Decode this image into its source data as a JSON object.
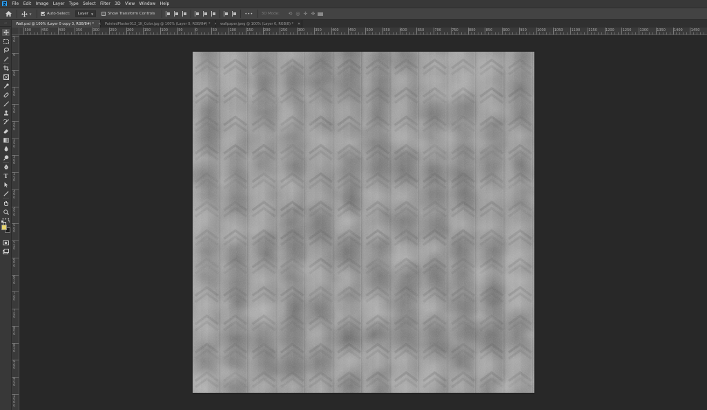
{
  "app": {
    "logo_text": "Ps"
  },
  "menu": [
    "File",
    "Edit",
    "Image",
    "Layer",
    "Type",
    "Select",
    "Filter",
    "3D",
    "View",
    "Window",
    "Help"
  ],
  "options_bar": {
    "auto_select_label": "Auto-Select:",
    "auto_select_checked": true,
    "auto_select_target": "Layer",
    "show_transform_label": "Show Transform Controls",
    "show_transform_checked": false,
    "more_label": "•••",
    "mode_3d_label": "3D Mode:"
  },
  "tabs": [
    {
      "label": "Wall.psd @ 100% (Layer 0 copy 3, RGB/8#) *",
      "active": true
    },
    {
      "label": "PaintedPlaster012_1K_Color.jpg @ 100% (Layer 0, RGB/8#) *",
      "active": false
    },
    {
      "label": "wallpaper.jpeg @ 100% (Layer 0, RGB/8) *",
      "active": false
    }
  ],
  "ruler_top_labels": [
    "500",
    "450",
    "400",
    "350",
    "300",
    "250",
    "200",
    "150",
    "100",
    "50",
    "0",
    "50",
    "100",
    "150",
    "200",
    "250",
    "300",
    "350",
    "400",
    "450",
    "500",
    "550",
    "600",
    "650",
    "700",
    "750",
    "800",
    "850",
    "900",
    "950",
    "1000",
    "1050",
    "1100",
    "1150",
    "1200",
    "1250",
    "1300",
    "1350",
    "1400",
    "1450",
    "1500"
  ],
  "ruler_left_labels": [
    "50",
    "0",
    "50",
    "100",
    "150",
    "200",
    "250",
    "300",
    "350",
    "400",
    "450",
    "500",
    "550",
    "600",
    "650",
    "700",
    "750",
    "800",
    "850",
    "900",
    "950",
    "1000"
  ],
  "colors": {
    "foreground": "#e8d56c",
    "background": "#1f1f1f",
    "workspace": "#282828"
  },
  "tools": [
    "move-icon",
    "marquee-icon",
    "lasso-icon",
    "magic-wand-icon",
    "crop-icon",
    "frame-icon",
    "eyedropper-icon",
    "healing-brush-icon",
    "brush-icon",
    "clone-stamp-icon",
    "history-brush-icon",
    "eraser-icon",
    "gradient-icon",
    "blur-icon",
    "dodge-icon",
    "pen-icon",
    "type-icon",
    "path-selection-icon",
    "line-icon",
    "hand-icon",
    "zoom-icon",
    "more-tools-icon"
  ]
}
